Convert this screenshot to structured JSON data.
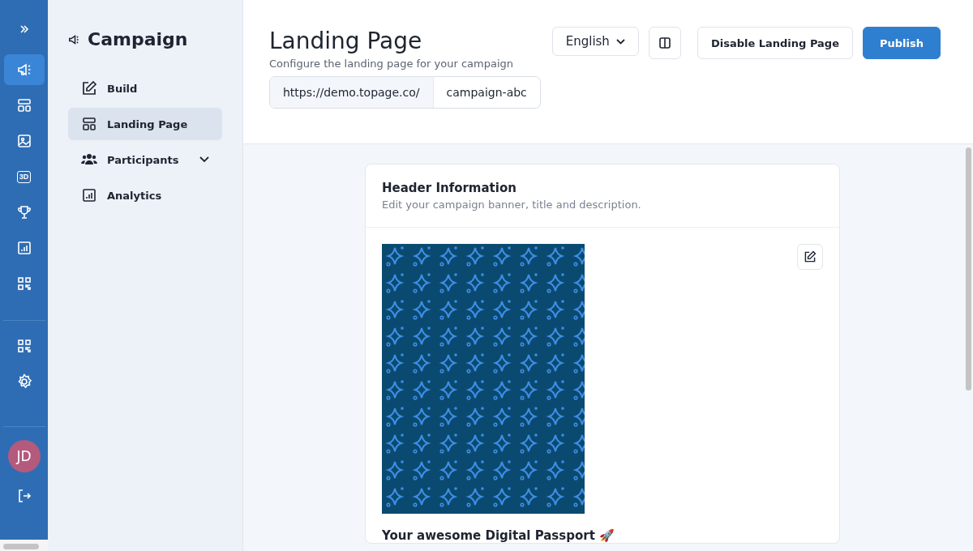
{
  "rail": {
    "items": [
      {
        "selected": true
      },
      {
        "selected": false
      },
      {
        "selected": false
      },
      {
        "selected": false,
        "label": "3D"
      },
      {
        "selected": false
      },
      {
        "selected": false
      },
      {
        "selected": false
      }
    ],
    "avatar": "JD"
  },
  "sidebar": {
    "title": "Campaign",
    "items": [
      {
        "label": "Build",
        "selected": false
      },
      {
        "label": "Landing Page",
        "selected": true
      },
      {
        "label": "Participants",
        "selected": false,
        "expanded": false
      },
      {
        "label": "Analytics",
        "selected": false
      }
    ]
  },
  "header": {
    "title": "Landing Page",
    "subtitle": "Configure the landing page for your campaign",
    "language": "English",
    "buttons": [
      "Disable Landing Page",
      "Publish"
    ],
    "url_prefix": "https://demo.topage.co/",
    "slug": "campaign-abc"
  },
  "card": {
    "title": "Header Information",
    "description": "Edit your campaign banner, title and description.",
    "campaign_title": "Your awesome Digital Passport 🚀"
  }
}
